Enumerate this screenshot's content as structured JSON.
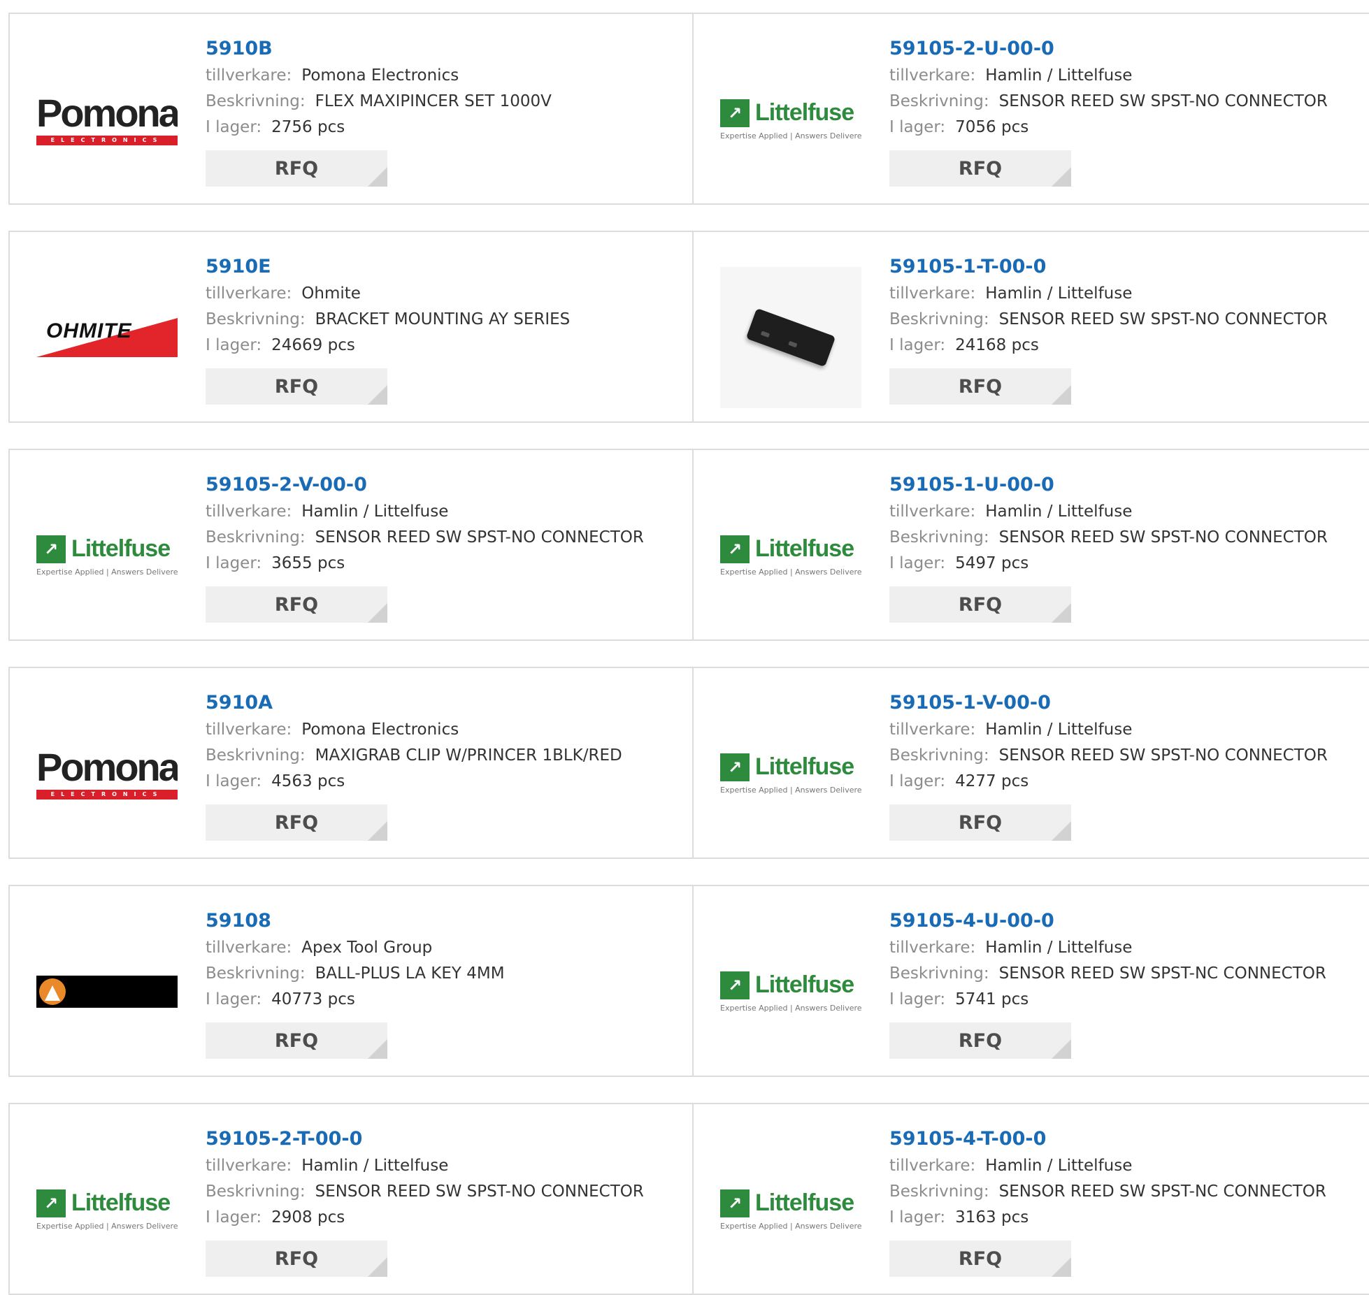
{
  "labels": {
    "manufacturer": "tillverkare:",
    "description": "Beskrivning:",
    "stock": "I lager:"
  },
  "rfq_label": "RFQ",
  "rows": [
    {
      "left": {
        "part_number": "5910B",
        "manufacturer": "Pomona Electronics",
        "description": "FLEX MAXIPINCER SET 1000V",
        "stock": "2756 pcs",
        "logo": "pomona"
      },
      "right": {
        "part_number": "59105-2-U-00-0",
        "manufacturer": "Hamlin / Littelfuse",
        "description": "SENSOR REED SW SPST-NO CONNECTOR",
        "stock": "7056 pcs",
        "logo": "littelfuse"
      }
    },
    {
      "left": {
        "part_number": "5910E",
        "manufacturer": "Ohmite",
        "description": "BRACKET MOUNTING AY SERIES",
        "stock": "24669 pcs",
        "logo": "ohmite"
      },
      "right": {
        "part_number": "59105-1-T-00-0",
        "manufacturer": "Hamlin / Littelfuse",
        "description": "SENSOR REED SW SPST-NO CONNECTOR",
        "stock": "24168 pcs",
        "logo": "product-photo"
      }
    },
    {
      "left": {
        "part_number": "59105-2-V-00-0",
        "manufacturer": "Hamlin / Littelfuse",
        "description": "SENSOR REED SW SPST-NO CONNECTOR",
        "stock": "3655 pcs",
        "logo": "littelfuse"
      },
      "right": {
        "part_number": "59105-1-U-00-0",
        "manufacturer": "Hamlin / Littelfuse",
        "description": "SENSOR REED SW SPST-NO CONNECTOR",
        "stock": "5497 pcs",
        "logo": "littelfuse"
      }
    },
    {
      "left": {
        "part_number": "5910A",
        "manufacturer": "Pomona Electronics",
        "description": "MAXIGRAB CLIP W/PRINCER 1BLK/RED",
        "stock": "4563 pcs",
        "logo": "pomona"
      },
      "right": {
        "part_number": "59105-1-V-00-0",
        "manufacturer": "Hamlin / Littelfuse",
        "description": "SENSOR REED SW SPST-NO CONNECTOR",
        "stock": "4277 pcs",
        "logo": "littelfuse"
      }
    },
    {
      "left": {
        "part_number": "59108",
        "manufacturer": "Apex Tool Group",
        "description": "BALL-PLUS LA KEY 4MM",
        "stock": "40773 pcs",
        "logo": "apex"
      },
      "right": {
        "part_number": "59105-4-U-00-0",
        "manufacturer": "Hamlin / Littelfuse",
        "description": "SENSOR REED SW SPST-NC CONNECTOR",
        "stock": "5741 pcs",
        "logo": "littelfuse"
      }
    },
    {
      "left": {
        "part_number": "59105-2-T-00-0",
        "manufacturer": "Hamlin / Littelfuse",
        "description": "SENSOR REED SW SPST-NO CONNECTOR",
        "stock": "2908 pcs",
        "logo": "littelfuse"
      },
      "right": {
        "part_number": "59105-4-T-00-0",
        "manufacturer": "Hamlin / Littelfuse",
        "description": "SENSOR REED SW SPST-NC CONNECTOR",
        "stock": "3163 pcs",
        "logo": "littelfuse"
      }
    }
  ],
  "logo_text": {
    "pomona_word": "Pomona.",
    "pomona_sub": "ELECTRONICS",
    "littelfuse_word": "Littelfuse",
    "littelfuse_tag": "Expertise Applied | Answers Delivered",
    "ohmite_word": "OHMITE"
  },
  "colors": {
    "link": "#1a6bb5",
    "label": "#8c8c8c",
    "value": "#333333",
    "button_bg": "#efefef",
    "border": "#dcdcdc",
    "littelfuse_green": "#2e8b3e",
    "pomona_red": "#d81f2a",
    "ohmite_red": "#e1252b"
  }
}
